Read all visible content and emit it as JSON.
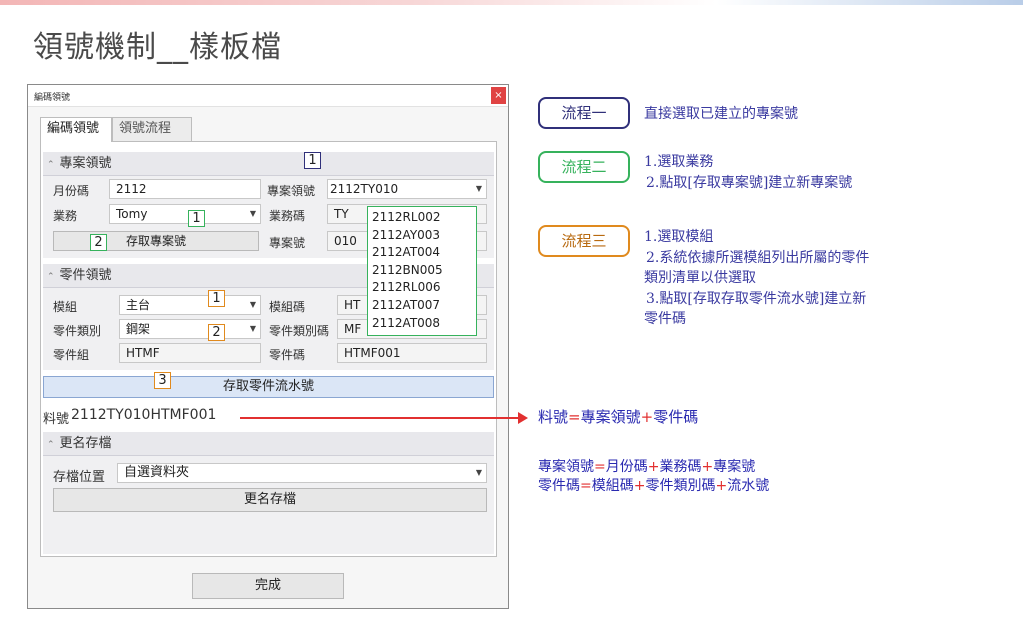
{
  "slide": {
    "title": "領號機制__樣板檔"
  },
  "dialog": {
    "title": "編碼領號",
    "close_glyph": "×",
    "tabs": [
      {
        "label": "編碼領號"
      },
      {
        "label": "領號流程"
      }
    ],
    "project_section": {
      "header": "專案領號",
      "month_code_label": "月份碼",
      "month_code_value": "2112",
      "project_code_label": "專案領號",
      "project_code_value": "2112TY010",
      "business_label": "業務",
      "business_value": "Tomy",
      "business_code_label": "業務碼",
      "business_code_value": "TY",
      "fetch_project_button": "存取專案號",
      "project_number_label": "專案號",
      "project_number_value": "010"
    },
    "project_dropdown_options": [
      "2112RL002",
      "2112AY003",
      "2112AT004",
      "2112BN005",
      "2112RL006",
      "2112AT007",
      "2112AT008"
    ],
    "part_section": {
      "header": "零件領號",
      "module_label": "模組",
      "module_value": "主台",
      "module_code_label": "模組碼",
      "module_code_value": "HT",
      "part_category_label": "零件類別",
      "part_category_value": "鋼架",
      "part_category_code_label": "零件類別碼",
      "part_category_code_value": "MF",
      "part_group_label": "零件組",
      "part_group_value": "HTMF",
      "part_code_label": "零件碼",
      "part_code_value": "HTMF001",
      "fetch_serial_button": "存取零件流水號"
    },
    "material_number": {
      "label": "料號",
      "value": "2112TY010HTMF001"
    },
    "rename_section": {
      "header": "更名存檔",
      "location_label": "存檔位置",
      "location_value": "自選資料夾",
      "rename_button": "更名存檔"
    },
    "done_button": "完成",
    "markers": {
      "m1": "1",
      "m2": "1",
      "m3": "2",
      "m4": "1",
      "m5": "2",
      "m6": "3"
    }
  },
  "flows": [
    {
      "label": "流程一",
      "color": "#30307a",
      "lines": [
        "直接選取已建立的專案號"
      ]
    },
    {
      "label": "流程二",
      "color": "#36b25c",
      "lines": [
        "1.選取業務",
        "2.點取[存取專案號]建立新專案號"
      ]
    },
    {
      "label": "流程三",
      "color": "#e08a1e",
      "lines": [
        "1.選取模組",
        "2.系統依據所選模組列出所屬的零件",
        "類別清單以供選取",
        "3.點取[存取存取零件流水號]建立新",
        "零件碼"
      ]
    }
  ],
  "formulas": {
    "material": {
      "lhs": "料號",
      "eq": "=",
      "a": "專案領號",
      "plus": "+",
      "b": "零件碼"
    },
    "project": {
      "lhs": "專案領號",
      "eq": "=",
      "a": "月份碼",
      "plus1": "+",
      "b": "業務碼",
      "plus2": "+",
      "c": "專案號"
    },
    "part": {
      "lhs": "零件碼",
      "eq": "=",
      "a": "模組碼",
      "plus1": "+",
      "b": "零件類別碼",
      "plus2": "+",
      "c": "流水號"
    }
  },
  "colors": {
    "arrow": "#e23030",
    "formula_text": "#2a2ab0",
    "flow_text": "#3a3aa0"
  }
}
